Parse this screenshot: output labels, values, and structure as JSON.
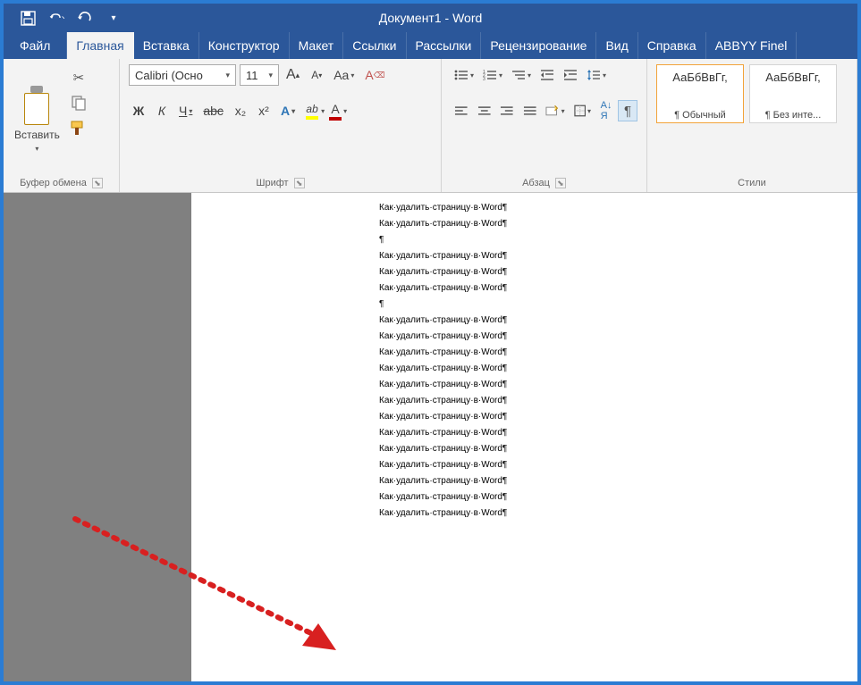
{
  "title": "Документ1  -  Word",
  "tabs": [
    "Файл",
    "Главная",
    "Вставка",
    "Конструктор",
    "Макет",
    "Ссылки",
    "Рассылки",
    "Рецензирование",
    "Вид",
    "Справка",
    "ABBYY Finel"
  ],
  "active_tab": 1,
  "clipboard": {
    "paste": "Вставить",
    "group": "Буфер обмена"
  },
  "font": {
    "name": "Calibri (Осно",
    "size": "11",
    "group": "Шрифт",
    "bold": "Ж",
    "italic": "К",
    "underline": "Ч",
    "strike": "abc",
    "sub": "x₂",
    "sup": "x²",
    "aa": "Aa",
    "clear": "A"
  },
  "para": {
    "group": "Абзац"
  },
  "styles": {
    "group": "Стили",
    "items": [
      {
        "sample": "АаБбВвГг,",
        "name": "¶ Обычный"
      },
      {
        "sample": "АаБбВвГг,",
        "name": "¶ Без инте..."
      }
    ]
  },
  "doc": {
    "line": "Как·удалить·страницу·в·Word",
    "blocks": [
      1,
      1,
      0,
      1,
      1,
      1,
      0,
      1,
      1,
      1,
      1,
      1,
      1,
      1,
      1,
      1,
      1,
      1,
      1,
      1
    ]
  }
}
